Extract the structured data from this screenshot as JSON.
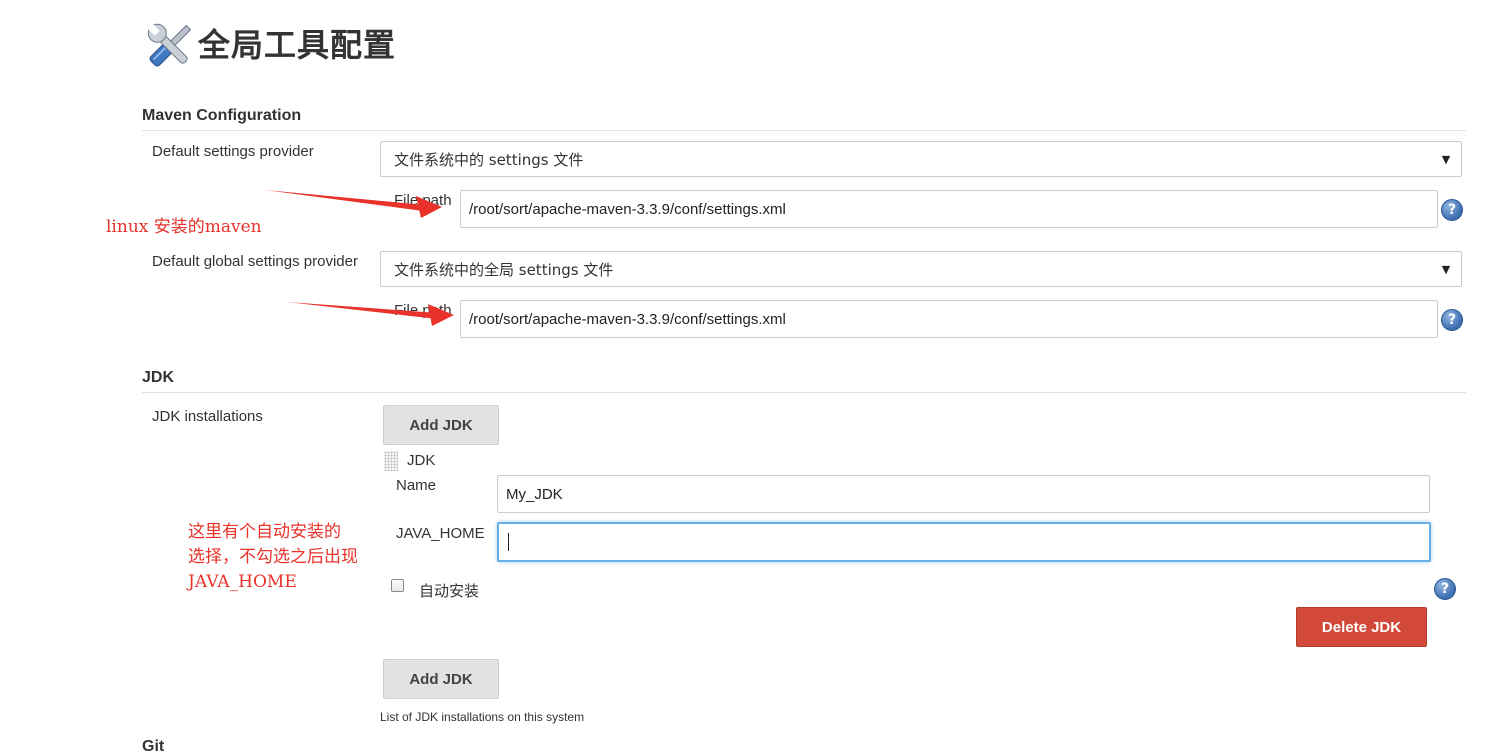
{
  "page": {
    "title": "全局工具配置",
    "title_icon": "tools-wrench-screwdriver-icon"
  },
  "maven": {
    "section_title": "Maven Configuration",
    "settings_provider_label": "Default settings provider",
    "settings_provider_value": "文件系统中的 settings 文件",
    "file_path_label": "File path",
    "settings_file_path": "/root/sort/apache-maven-3.3.9/conf/settings.xml",
    "global_settings_provider_label": "Default global settings provider",
    "global_settings_provider_value": "文件系统中的全局 settings 文件",
    "global_file_path_label": "File path",
    "global_settings_file_path": "/root/sort/apache-maven-3.3.9/conf/settings.xml"
  },
  "jdk": {
    "section_title": "JDK",
    "installations_label": "JDK installations",
    "add_button_label": "Add JDK",
    "item_title": "JDK",
    "name_label": "Name",
    "name_value": "My_JDK",
    "java_home_label": "JAVA_HOME",
    "java_home_value": "",
    "auto_install_label": "自动安装",
    "auto_install_checked": false,
    "delete_button_label": "Delete JDK",
    "add_button_bottom_label": "Add JDK",
    "help_text": "List of JDK installations on this system"
  },
  "git": {
    "section_title": "Git"
  },
  "annotations": {
    "maven_note": "linux 安装的maven",
    "jdk_note_line1": "这里有个自动安装的",
    "jdk_note_line2": "选择，不勾选之后出现",
    "jdk_note_line3": "JAVA_HOME",
    "color": "#e8322a"
  },
  "colors": {
    "delete_button": "#d24939",
    "focus_ring": "#66afe9",
    "help_icon": "#3b6db0"
  }
}
